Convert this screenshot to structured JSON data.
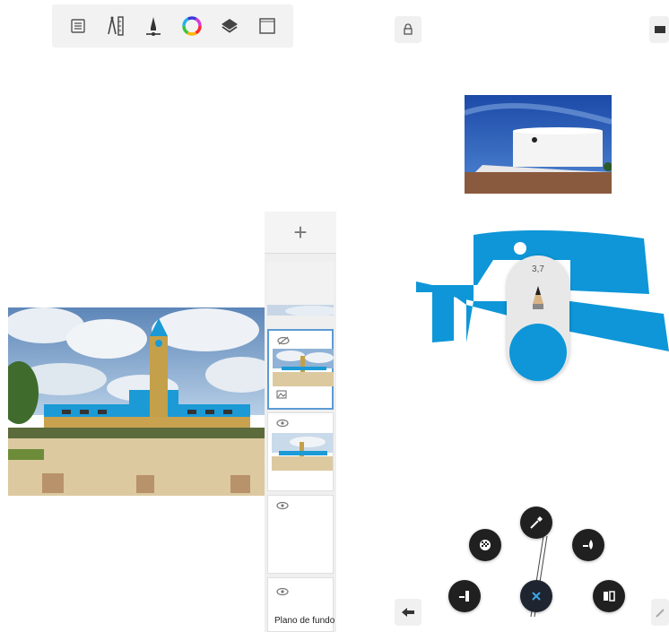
{
  "left_panel": {
    "toolbar": {
      "tools": [
        {
          "icon": "list-menu-icon"
        },
        {
          "icon": "ruler-compass-icon"
        },
        {
          "icon": "brush-icon"
        },
        {
          "icon": "color-wheel-icon"
        },
        {
          "icon": "layers-icon"
        },
        {
          "icon": "canvas-frame-icon"
        }
      ]
    },
    "layers": {
      "add_label": "+",
      "background_label": "Plano de fundo"
    }
  },
  "right_panel": {
    "brush_size": "3,7",
    "colors": {
      "accent_blue": "#0e96d8",
      "dark_button": "#202020",
      "selection": "#5b9bd5"
    },
    "radial_menu": {
      "items": [
        {
          "icon": "eyedropper-icon"
        },
        {
          "icon": "fill-pattern-icon"
        },
        {
          "icon": "drop-fill-icon"
        },
        {
          "icon": "marker-icon"
        },
        {
          "icon": "close-icon"
        },
        {
          "icon": "mirror-icon"
        }
      ]
    }
  }
}
